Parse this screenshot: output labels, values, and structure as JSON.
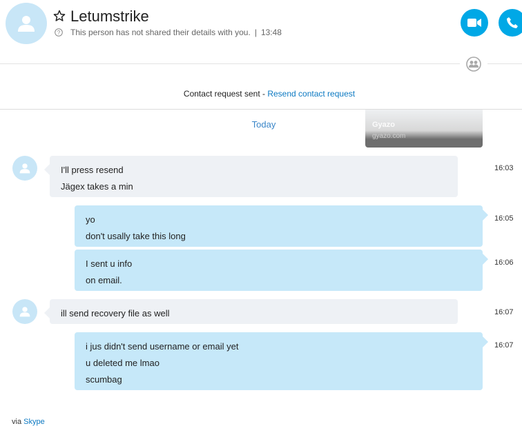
{
  "header": {
    "contact_name": "Letumstrike",
    "details_text": "This person has not shared their details with you.",
    "separator": "|",
    "time": "13:48",
    "avatar_icon": "person-icon",
    "favorite_icon": "star-icon",
    "video_call_icon": "video-camera-icon",
    "audio_call_icon": "phone-icon",
    "accent_color": "#00a8e6"
  },
  "contact_request": {
    "sent_text": "Contact request sent - ",
    "resend_link": "Resend contact request"
  },
  "day_divider": "Today",
  "screenshot_overlay": {
    "title": "Gyazo",
    "subtitle": "gyazo.com"
  },
  "messages": [
    {
      "direction": "incoming",
      "lines": [
        "I'll press resend",
        "Jägex takes a min"
      ],
      "time": "16:03"
    },
    {
      "direction": "outgoing",
      "lines": [
        "yo",
        "don't usally take this long"
      ],
      "time": "16:05"
    },
    {
      "direction": "outgoing",
      "lines": [
        "I sent u info",
        "on email."
      ],
      "time": "16:06"
    },
    {
      "direction": "incoming",
      "lines": [
        "ill send recovery file as well"
      ],
      "time": "16:07"
    },
    {
      "direction": "outgoing",
      "lines": [
        "i jus didn't send username or email yet",
        "u deleted me lmao",
        "scumbag"
      ],
      "time": "16:07"
    }
  ],
  "footer": {
    "via_text": "via ",
    "via_link": "Skype"
  }
}
